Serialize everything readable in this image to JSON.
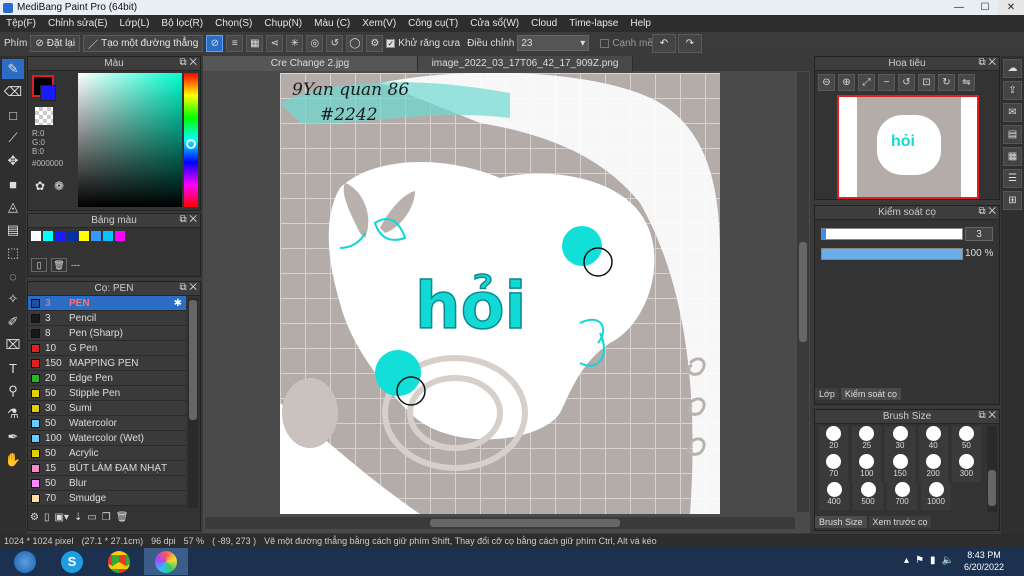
{
  "window": {
    "title": "MediBang Paint Pro (64bit)"
  },
  "menu": [
    "Tệp(F)",
    "Chỉnh sửa(E)",
    "Lớp(L)",
    "Bộ lọc(R)",
    "Chọn(S)",
    "Chụp(N)",
    "Màu (C)",
    "Xem(V)",
    "Công cụ(T)",
    "Cửa sổ(W)",
    "Cloud",
    "Time-lapse",
    "Help"
  ],
  "toolopts": {
    "phim_label": "Phím",
    "reset_label": "Đặt lại",
    "line_label": "Tạo một đường thẳng",
    "antialias_label": "Khử răng cưa",
    "adjust_label": "Điều chỉnh",
    "adjust_value": "23",
    "edge_label": "Cạnh mềm"
  },
  "color_panel": {
    "title": "Màu",
    "r": "R:0",
    "g": "G:0",
    "b": "B:0",
    "hex": "#000000"
  },
  "palette_panel": {
    "title": "Bảng màu",
    "dash": "---",
    "colors": [
      "#ffffff",
      "#00ffff",
      "#1a1aff",
      "#0033aa",
      "#ffff00",
      "#3399ff",
      "#00c8ff",
      "#ff00ff"
    ]
  },
  "brush_panel": {
    "title": "Cọ: PEN",
    "items": [
      {
        "size": "3",
        "name": "PEN",
        "color": "#1f4fa0",
        "selected": true
      },
      {
        "size": "3",
        "name": "Pencil",
        "color": "#1a1a1a"
      },
      {
        "size": "8",
        "name": "Pen (Sharp)",
        "color": "#1a1a1a"
      },
      {
        "size": "10",
        "name": "G Pen",
        "color": "#e02020"
      },
      {
        "size": "150",
        "name": "MAPPING PEN",
        "color": "#e02020"
      },
      {
        "size": "20",
        "name": "Edge Pen",
        "color": "#22bb22"
      },
      {
        "size": "50",
        "name": "Stipple Pen",
        "color": "#e0d000"
      },
      {
        "size": "30",
        "name": "Sumi",
        "color": "#e0d000"
      },
      {
        "size": "50",
        "name": "Watercolor",
        "color": "#66ccff"
      },
      {
        "size": "100",
        "name": "Watercolor (Wet)",
        "color": "#66ccff"
      },
      {
        "size": "50",
        "name": "Acrylic",
        "color": "#e0d000"
      },
      {
        "size": "15",
        "name": "BÚT LÀM ĐẠM NHẠT",
        "color": "#ff88cc"
      },
      {
        "size": "50",
        "name": "Blur",
        "color": "#ff88ff"
      },
      {
        "size": "70",
        "name": "Smudge",
        "color": "#ffe0a0"
      }
    ]
  },
  "tabs": [
    {
      "label": "Cre Change 2.jpg",
      "active": true
    },
    {
      "label": "image_2022_03_17T06_42_17_909Z.png",
      "active": false
    }
  ],
  "artwork": {
    "handwriting_line1": "9Yan quan 86",
    "handwriting_line2": "#2242",
    "word": "hỏi"
  },
  "navigator": {
    "title": "Hoa tiêu"
  },
  "brush_control": {
    "title": "Kiểm soát cọ",
    "size_value": "3",
    "opacity_value": "100 %",
    "opacity_fraction": 1.0,
    "tab_layer": "Lớp",
    "tab_control": "Kiểm soát cọ"
  },
  "brush_size": {
    "title": "Brush Size",
    "sizes_row1": [
      "20",
      "25",
      "30",
      "40",
      "50"
    ],
    "sizes_row2": [
      "70",
      "100",
      "150",
      "200",
      "300"
    ],
    "sizes_row3": [
      "400",
      "500",
      "700",
      "1000"
    ],
    "tab1": "Brush Size",
    "tab2": "Xem trước cọ"
  },
  "status": {
    "size": "1024 * 1024 pixel",
    "cm": "(27.1 * 27.1cm)",
    "dpi": "96 dpi",
    "zoom": "57 %",
    "coords": "( -89, 273 )",
    "hint": "Vẽ một đường thẳng bằng cách giữ phím Shift, Thay đổi cỡ cọ bằng cách giữ phím Ctrl, Alt và kéo"
  },
  "taskbar": {
    "time": "8:43 PM",
    "date": "6/20/2022"
  }
}
